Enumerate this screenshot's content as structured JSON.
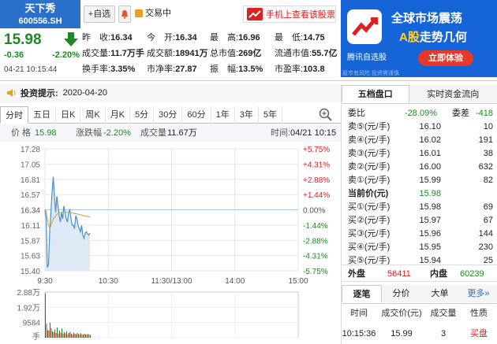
{
  "stock": {
    "name": "天下秀",
    "code": "600556.SH",
    "price": "15.98",
    "change": "-0.36",
    "change_pct": "-2.20%",
    "datetime": "04-21 10:15:44"
  },
  "toolbar": {
    "watchlist": "+自选",
    "trading": "交易中",
    "mobile": "手机上查看该股票"
  },
  "quote": [
    [
      {
        "l": "昨　收:",
        "v": "16.34",
        "c": "b"
      },
      {
        "l": "今　开:",
        "v": "16.34",
        "c": "b"
      },
      {
        "l": "最　高:",
        "v": "16.96",
        "c": "b"
      },
      {
        "l": "最　低:",
        "v": "14.75",
        "c": "b"
      }
    ],
    [
      {
        "l": "成交量:",
        "v": "11.7万手",
        "c": "b"
      },
      {
        "l": "成交额:",
        "v": "18941万",
        "c": "b"
      },
      {
        "l": "总市值:",
        "v": "269亿",
        "c": "b"
      },
      {
        "l": "流通市值:",
        "v": "55.7亿",
        "c": "b"
      }
    ],
    [
      {
        "l": "换手率:",
        "v": "3.35%",
        "c": "b"
      },
      {
        "l": "市净率:",
        "v": "27.87",
        "c": "b"
      },
      {
        "l": "振　幅:",
        "v": "13.5%",
        "c": "b"
      },
      {
        "l": "市盈率:",
        "v": "103.8",
        "c": "b"
      }
    ]
  ],
  "ad": {
    "line1": "全球市场震荡",
    "line2_a": "A股",
    "line2_b": "走势几何",
    "brand": "腾讯自选股",
    "button": "立即体验",
    "note": "股市有风险 投资需谨慎"
  },
  "notice": {
    "label": "投资提示:",
    "date": "2020-04-20"
  },
  "tabs": [
    "分时",
    "五日",
    "日K",
    "周K",
    "月K",
    "5分",
    "30分",
    "60分",
    "1年",
    "3年",
    "5年"
  ],
  "info": {
    "price_label": "价 格",
    "price": "15.98",
    "chg_label": "涨跌幅",
    "chg": "-2.20%",
    "vol_label": "成交量",
    "vol": "11.67万",
    "time_label": "时间:",
    "time": "04/21 10:15"
  },
  "chart_data": {
    "type": "line",
    "x_ticks": [
      "9:30",
      "10:30",
      "11:30/13:00",
      "14:00",
      "15:00"
    ],
    "y_ticks": [
      "17.28",
      "17.05",
      "16.81",
      "16.57",
      "16.34",
      "16.11",
      "15.87",
      "15.63",
      "15.40"
    ],
    "y_pct_ticks": [
      "+5.75%",
      "+4.31%",
      "+2.88%",
      "+1.44%",
      "0.00%",
      "-1.44%",
      "-2.88%",
      "-4.31%",
      "-5.75%"
    ],
    "ylim": [
      15.4,
      17.28
    ],
    "prev_close": 16.34,
    "series": [
      {
        "values": [
          16.34,
          16.2,
          15.45,
          15.5,
          16.0,
          16.3,
          16.6,
          16.85,
          16.55,
          16.3,
          16.55,
          16.4,
          16.25,
          16.15,
          16.3,
          16.2,
          16.4,
          16.3,
          16.2,
          16.15,
          16.3,
          16.35,
          16.2,
          16.1,
          16.1,
          16.05,
          16.25,
          16.2,
          16.1,
          16.05,
          16.0,
          16.1,
          15.95,
          15.9,
          15.98,
          16.0,
          15.97,
          15.95,
          15.98
        ]
      },
      {
        "values": [
          16.34,
          16.32,
          16.2,
          16.1,
          16.05,
          16.1,
          16.15,
          16.2,
          16.22,
          16.24,
          16.27,
          16.28,
          16.29,
          16.3,
          16.3,
          16.31,
          16.31,
          16.3,
          16.3,
          16.3,
          16.3,
          16.3,
          16.3,
          16.29,
          16.29,
          16.28,
          16.28,
          16.28,
          16.27,
          16.27,
          16.26,
          16.26,
          16.25,
          16.25,
          16.24,
          16.24,
          16.24,
          16.23,
          16.23
        ]
      }
    ],
    "volume": {
      "y_ticks": [
        "2.88万",
        "1.92万",
        "9584",
        "手"
      ],
      "max": 28800,
      "values": [
        28000,
        9000,
        5000,
        4500,
        9500,
        6000,
        4000,
        3500,
        5200,
        3000,
        6500,
        2500,
        4500,
        3000,
        5800,
        2500,
        3500,
        2800,
        4000,
        2200,
        3000,
        3800,
        2500,
        2000,
        3200,
        2600,
        2200,
        3000,
        2400,
        2000,
        2800,
        2200,
        1800,
        2500,
        2100,
        1900,
        2400,
        2000,
        1800
      ],
      "colors": [
        "r",
        "g",
        "r",
        "g",
        "r",
        "r",
        "g",
        "r",
        "g",
        "r",
        "g",
        "r",
        "g",
        "r",
        "g",
        "r",
        "g",
        "r",
        "g",
        "r",
        "g",
        "r",
        "g",
        "r",
        "g",
        "r",
        "g",
        "r",
        "g",
        "r",
        "g",
        "r",
        "g",
        "r",
        "g",
        "r",
        "g",
        "r",
        "g"
      ]
    }
  },
  "orderbook": {
    "title": "五档盘口",
    "title2": "实时资金流向",
    "ratio_label": "委比",
    "ratio": "-28.09%",
    "diff_label": "委差",
    "diff": "-418",
    "asks": [
      {
        "l": "卖⑤(元/手)",
        "p": "16.10",
        "v": "10"
      },
      {
        "l": "卖④(元/手)",
        "p": "16.02",
        "v": "191"
      },
      {
        "l": "卖③(元/手)",
        "p": "16.01",
        "v": "38"
      },
      {
        "l": "卖②(元/手)",
        "p": "16.00",
        "v": "632"
      },
      {
        "l": "卖①(元/手)",
        "p": "15.99",
        "v": "82"
      }
    ],
    "current_label": "当前价(元)",
    "current": "15.98",
    "bids": [
      {
        "l": "买①(元/手)",
        "p": "15.98",
        "v": "69"
      },
      {
        "l": "买②(元/手)",
        "p": "15.97",
        "v": "67"
      },
      {
        "l": "买③(元/手)",
        "p": "15.96",
        "v": "144"
      },
      {
        "l": "买④(元/手)",
        "p": "15.95",
        "v": "230"
      },
      {
        "l": "买⑤(元/手)",
        "p": "15.94",
        "v": "25"
      }
    ],
    "outer_label": "外盘",
    "outer": "56411",
    "inner_label": "内盘",
    "inner": "60239"
  },
  "trades": {
    "tabs": [
      "逐笔",
      "分价",
      "大单",
      "更多»"
    ],
    "headers": [
      "时间",
      "成交价(元)",
      "成交量",
      "性质"
    ],
    "rows": [
      {
        "time": "10:15:36",
        "price": "15.99",
        "vol": "3",
        "type": "买盘"
      }
    ]
  },
  "colors": {
    "up": "#e02020",
    "down": "#1b8a22",
    "line": "#4a90c8",
    "avg": "#c8a040",
    "blue": "#2a6fc9"
  }
}
